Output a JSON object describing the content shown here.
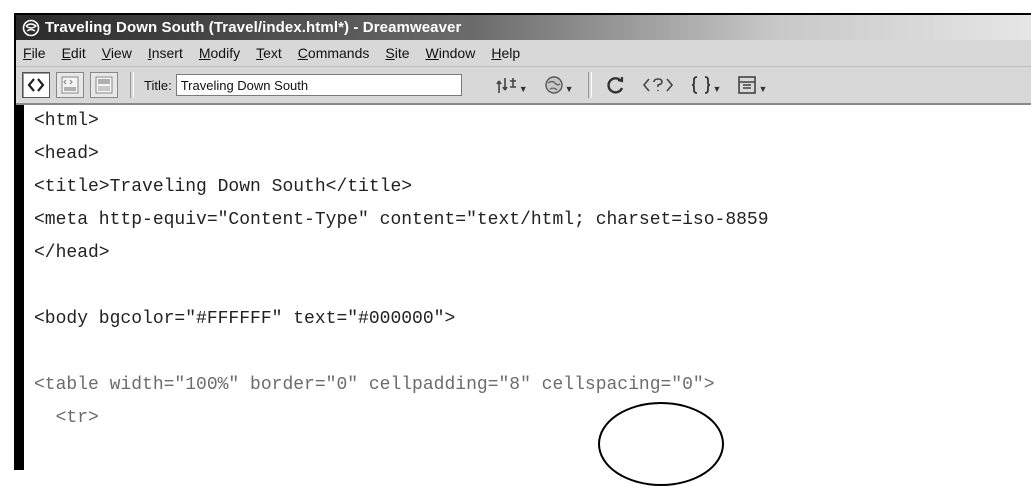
{
  "window": {
    "title": "Traveling Down South (Travel/index.html*) - Dreamweaver"
  },
  "menus": [
    {
      "underline": "F",
      "rest": "ile"
    },
    {
      "underline": "E",
      "rest": "dit"
    },
    {
      "underline": "V",
      "rest": "iew"
    },
    {
      "underline": "I",
      "rest": "nsert"
    },
    {
      "underline": "M",
      "rest": "odify"
    },
    {
      "underline": "T",
      "rest": "ext"
    },
    {
      "underline": "C",
      "rest": "ommands"
    },
    {
      "underline": "S",
      "rest": "ite"
    },
    {
      "underline": "W",
      "rest": "indow"
    },
    {
      "underline": "H",
      "rest": "elp"
    }
  ],
  "toolbar": {
    "title_label": "Title:",
    "title_value": "Traveling Down South",
    "tools": [
      "file-management-icon",
      "preview-browser-icon",
      "refresh-icon",
      "code-navigation-icon",
      "braces-icon",
      "view-options-icon"
    ]
  },
  "code": {
    "lines": [
      "<html>",
      "<head>",
      "<title>Traveling Down South</title>",
      "<meta http-equiv=\"Content-Type\" content=\"text/html; charset=iso-8859",
      "</head>",
      "",
      "<body bgcolor=\"#FFFFFF\" text=\"#000000\">",
      "",
      "<table width=\"100%\" border=\"0\" cellpadding=\"8\" cellspacing=\"0\">",
      "  <tr>"
    ]
  }
}
